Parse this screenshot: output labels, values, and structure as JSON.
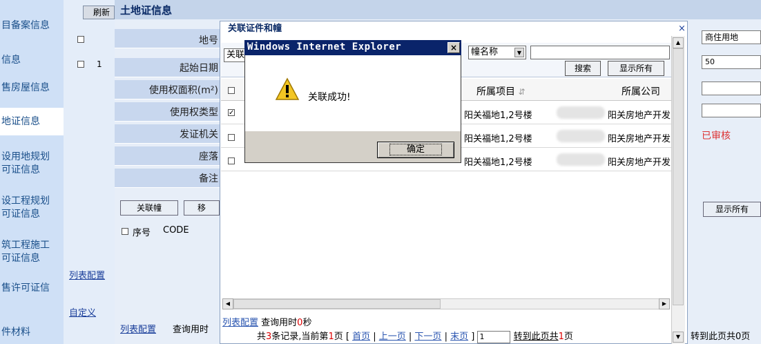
{
  "sidebar": {
    "items": [
      {
        "label": "目备案信息"
      },
      {
        "label": "信息"
      },
      {
        "label": "售房屋信息"
      },
      {
        "label": "地证信息"
      },
      {
        "label": "设用地规划",
        "label2": "可证信息"
      },
      {
        "label": "设工程规划",
        "label2": "可证信息"
      },
      {
        "label": "筑工程施工",
        "label2": "可证信息"
      },
      {
        "label": "售许可证信"
      },
      {
        "label": "件材料"
      }
    ]
  },
  "midcol": {
    "refresh": "刷新",
    "row_num": "1",
    "list_config": "列表配置",
    "custom": "自定义"
  },
  "form": {
    "title": "土地证信息",
    "labels": [
      "地号",
      "起始日期",
      "使用权面积(m²)",
      "使用权类型",
      "发证机关",
      "座落",
      "备注"
    ],
    "bind_btn": "关联幢",
    "move_btn": "移",
    "seq_header": "序号",
    "code_header": "CODE",
    "list_config": "列表配置",
    "query_time": "查询用时"
  },
  "right_strip": {
    "usage": "商住用地",
    "years": "50",
    "status": "已审核",
    "show_all": "显示所有",
    "footer": "转到此页共0页"
  },
  "dialog": {
    "title": "关联证件和幢",
    "close": "×",
    "bind_select": "关联",
    "field_select": "幢名称",
    "search_btn": "搜索",
    "show_all_btn": "显示所有",
    "headers": {
      "project": "所属项目",
      "company": "所属公司"
    },
    "rows": [
      {
        "checked": true,
        "project": "阳关福地1,2号楼",
        "company": "阳关房地产开发"
      },
      {
        "checked": false,
        "project": "阳关福地1,2号楼",
        "company": "阳关房地产开发"
      },
      {
        "checked": false,
        "project": "阳关福地1,2号楼",
        "company": "阳关房地产开发"
      }
    ],
    "footer": {
      "list_config": "列表配置",
      "query_prefix": "查询用时",
      "query_time": "0",
      "query_suffix": "秒",
      "total_prefix": "共",
      "total": "3",
      "total_mid": "条记录,当前第",
      "page": "1",
      "page_suffix": "页 [",
      "first": "首页",
      "prev": "上一页",
      "next": "下一页",
      "last": "末页",
      "bracket": "]",
      "goto_value": "1",
      "goto": "转到此页共",
      "pages": "1",
      "pages_suffix": "页"
    }
  },
  "alert": {
    "title": "Windows Internet Explorer",
    "message": "关联成功!",
    "ok": "确定",
    "close": "×"
  }
}
